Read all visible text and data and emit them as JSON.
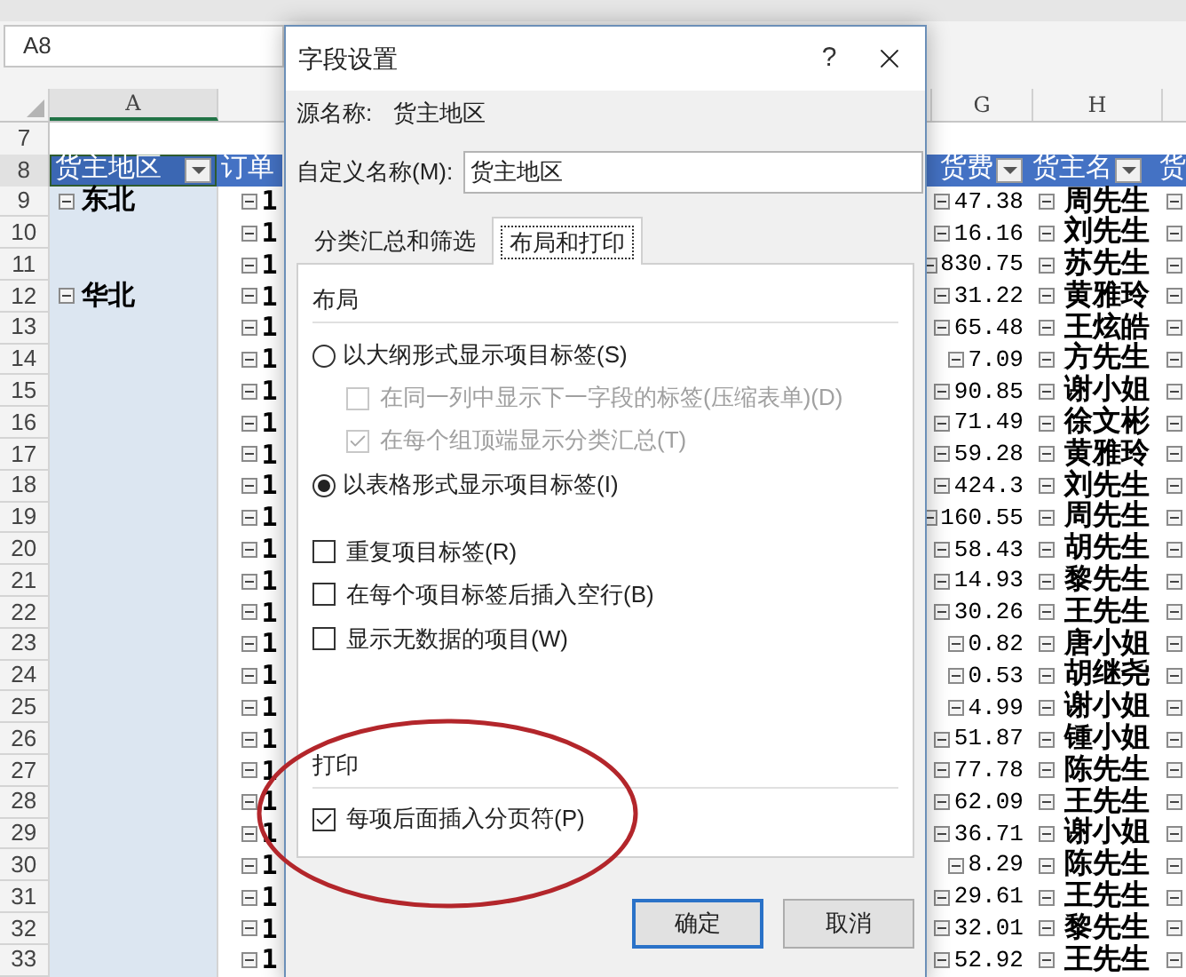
{
  "sheet": {
    "name_box": "A8",
    "columns": [
      "A",
      "G",
      "H"
    ],
    "row_numbers": [
      "7",
      "8"
    ],
    "header_cells": {
      "region": {
        "label": "货主地区",
        "selected": true
      },
      "order": "订单",
      "freight": "货费",
      "shipper": "货主名",
      "extra": "货"
    },
    "data_rows": [
      {
        "number": "9",
        "region": "东北",
        "order": "1",
        "freight": "47.38",
        "shipper": "周先生"
      },
      {
        "number": "10",
        "order": "1",
        "freight": "16.16",
        "shipper": "刘先生"
      },
      {
        "number": "11",
        "order": "1",
        "freight": "830.75",
        "shipper": "苏先生"
      },
      {
        "number": "12",
        "region": "华北",
        "order": "1",
        "freight": "31.22",
        "shipper": "黄雅玲"
      },
      {
        "number": "13",
        "order": "1",
        "freight": "65.48",
        "shipper": "王炫皓"
      },
      {
        "number": "14",
        "order": "1",
        "freight": "7.09",
        "shipper": "方先生"
      },
      {
        "number": "15",
        "order": "1",
        "freight": "90.85",
        "shipper": "谢小姐"
      },
      {
        "number": "16",
        "order": "1",
        "freight": "71.49",
        "shipper": "徐文彬"
      },
      {
        "number": "17",
        "order": "1",
        "freight": "59.28",
        "shipper": "黄雅玲"
      },
      {
        "number": "18",
        "order": "1",
        "freight": "424.3",
        "shipper": "刘先生"
      },
      {
        "number": "19",
        "order": "1",
        "freight": "160.55",
        "shipper": "周先生"
      },
      {
        "number": "20",
        "order": "1",
        "freight": "58.43",
        "shipper": "胡先生"
      },
      {
        "number": "21",
        "order": "1",
        "freight": "14.93",
        "shipper": "黎先生"
      },
      {
        "number": "22",
        "order": "1",
        "freight": "30.26",
        "shipper": "王先生"
      },
      {
        "number": "23",
        "order": "1",
        "freight": "0.82",
        "shipper": "唐小姐"
      },
      {
        "number": "24",
        "order": "1",
        "freight": "0.53",
        "shipper": "胡继尧"
      },
      {
        "number": "25",
        "order": "1",
        "freight": "4.99",
        "shipper": "谢小姐"
      },
      {
        "number": "26",
        "order": "1",
        "freight": "51.87",
        "shipper": "锺小姐"
      },
      {
        "number": "27",
        "order": "1",
        "freight": "77.78",
        "shipper": "陈先生"
      },
      {
        "number": "28",
        "order": "1",
        "freight": "62.09",
        "shipper": "王先生"
      },
      {
        "number": "29",
        "order": "1",
        "freight": "36.71",
        "shipper": "谢小姐"
      },
      {
        "number": "30",
        "order": "1",
        "freight": "8.29",
        "shipper": "陈先生"
      },
      {
        "number": "31",
        "order": "1",
        "freight": "29.61",
        "shipper": "王先生"
      },
      {
        "number": "32",
        "order": "1",
        "freight": "32.01",
        "shipper": "黎先生"
      },
      {
        "number": "33",
        "order": "1",
        "freight": "52.92",
        "shipper": "王先生"
      }
    ]
  },
  "dialog": {
    "title": "字段设置",
    "help": "?",
    "source_label": "源名称:",
    "source_value": "货主地区",
    "custom_name_label": "自定义名称(M):",
    "custom_name_value": "货主地区",
    "tabs": [
      {
        "label": "分类汇总和筛选",
        "selected": false
      },
      {
        "label": "布局和打印",
        "selected": true
      }
    ],
    "layout_title": "布局",
    "layout_options": [
      {
        "kind": "radio",
        "label": "以大纲形式显示项目标签(S)",
        "selected": false,
        "children": [
          {
            "kind": "checkbox",
            "label": "在同一列中显示下一字段的标签(压缩表单)(D)",
            "checked": false,
            "disabled": true
          },
          {
            "kind": "checkbox",
            "label": "在每个组顶端显示分类汇总(T)",
            "checked": true,
            "disabled": true
          }
        ]
      },
      {
        "kind": "radio",
        "label": "以表格形式显示项目标签(I)",
        "selected": true
      }
    ],
    "layout_checkboxes": [
      {
        "label": "重复项目标签(R)",
        "checked": false
      },
      {
        "label": "在每个项目标签后插入空行(B)",
        "checked": false
      },
      {
        "label": "显示无数据的项目(W)",
        "checked": false
      }
    ],
    "print_title": "打印",
    "print_options": [
      {
        "label": "每项后面插入分页符(P)",
        "checked": true
      }
    ],
    "buttons": [
      {
        "label": "确定",
        "default": true
      },
      {
        "label": "取消",
        "default": false
      }
    ]
  }
}
